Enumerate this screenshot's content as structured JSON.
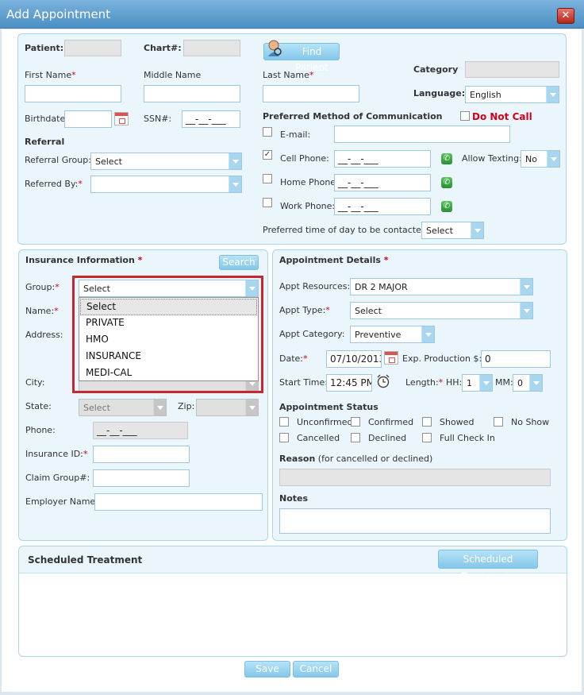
{
  "window": {
    "title": "Add Appointment"
  },
  "patient": {
    "patient_label": "Patient:",
    "chart_label": "Chart#:",
    "find_patient_label": "Find Patient",
    "category_label": "Category",
    "first_name_label": "First Name",
    "middle_name_label": "Middle Name",
    "last_name_label": "Last Name",
    "language_label": "Language:",
    "language_value": "English",
    "birthdate_label": "Birthdate:",
    "ssn_label": "SSN#:",
    "ssn_placeholder": "__-__-___",
    "required_mark": "*"
  },
  "referral": {
    "heading": "Referral",
    "group_label": "Referral Group:",
    "group_value": "Select",
    "referred_by_label": "Referred By:",
    "referred_by_value": ""
  },
  "communication": {
    "heading": "Preferred Method of Communication",
    "do_not_call_label": "Do Not Call",
    "email_label": "E-mail:",
    "cell_label": "Cell Phone:",
    "home_label": "Home Phone:",
    "work_label": "Work Phone:",
    "phone_mask": "__-__-___",
    "allow_texting_label": "Allow Texting:",
    "allow_texting_value": "No",
    "preferred_time_label": "Preferred time of day to be contacted:",
    "preferred_time_value": "Select",
    "cell_checked": true,
    "checkmark": "✓",
    "phone_icon": "phone-icon",
    "phone_glyph": "✆"
  },
  "insurance": {
    "heading": "Insurance Information",
    "search_label": "Search",
    "group_label": "Group:",
    "group_value": "Select",
    "group_options": [
      "Select",
      "PRIVATE",
      "HMO",
      "INSURANCE",
      "MEDI-CAL"
    ],
    "name_label": "Name:",
    "address_label": "Address:",
    "city_label": "City:",
    "state_label": "State:",
    "state_value": "Select",
    "zip_label": "Zip:",
    "phone_label": "Phone:",
    "phone_mask": "__-__-___",
    "insurance_id_label": "Insurance ID:",
    "claim_group_label": "Claim Group#:",
    "employer_label": "Employer Name:"
  },
  "appointment": {
    "heading": "Appointment Details",
    "resources_label": "Appt Resources:",
    "resources_value": "DR 2 MAJOR",
    "type_label": "Appt Type:",
    "type_value": "Select",
    "category_label": "Appt Category:",
    "category_value": "Preventive",
    "date_label": "Date:",
    "date_value": "07/10/2013",
    "exp_production_label": "Exp. Production $:",
    "exp_production_value": "0",
    "start_time_label": "Start Time:",
    "start_time_value": "12:45 PM",
    "length_label": "Length:",
    "hh_label": "HH:",
    "hh_value": "1",
    "mm_label": "MM:",
    "mm_value": "0",
    "clock_icon": "clock-icon",
    "status_heading": "Appointment Status",
    "statuses": [
      "Unconfirmed",
      "Confirmed",
      "Showed",
      "No Show",
      "Cancelled",
      "Declined",
      "Full Check In"
    ],
    "reason_label": "Reason",
    "reason_hint": "(for cancelled or declined)",
    "notes_label": "Notes"
  },
  "scheduled": {
    "heading": "Scheduled Treatment",
    "button_label": "Scheduled Treatments"
  },
  "footer": {
    "save_label": "Save",
    "cancel_label": "Cancel"
  },
  "colors": {
    "accent": "#84c7ea",
    "required": "#d0021b",
    "highlight": "#c8272e",
    "panel_bg": "#eaf6fc"
  }
}
